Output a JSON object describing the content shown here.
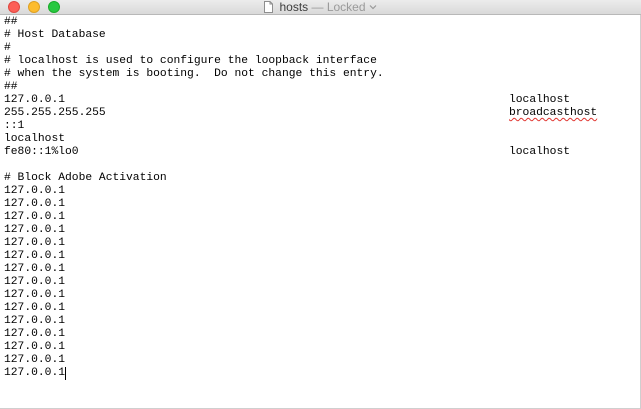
{
  "window": {
    "title": "hosts",
    "separator": " — ",
    "state": "Locked"
  },
  "editor": {
    "lines": [
      {
        "text": "##",
        "host": ""
      },
      {
        "text": "# Host Database",
        "host": ""
      },
      {
        "text": "#",
        "host": ""
      },
      {
        "text": "# localhost is used to configure the loopback interface",
        "host": ""
      },
      {
        "text": "# when the system is booting.  Do not change this entry.",
        "host": ""
      },
      {
        "text": "##",
        "host": ""
      },
      {
        "text": "127.0.0.1",
        "host": "localhost"
      },
      {
        "text": "255.255.255.255",
        "host": "broadcasthost",
        "misspelled": true
      },
      {
        "text": "::1",
        "host": ""
      },
      {
        "text": "localhost",
        "host": ""
      },
      {
        "text": "fe80::1%lo0",
        "host": "localhost"
      },
      {
        "text": "",
        "host": ""
      },
      {
        "text": "# Block Adobe Activation",
        "host": ""
      },
      {
        "text": "127.0.0.1",
        "host": ""
      },
      {
        "text": "127.0.0.1",
        "host": ""
      },
      {
        "text": "127.0.0.1",
        "host": ""
      },
      {
        "text": "127.0.0.1",
        "host": ""
      },
      {
        "text": "127.0.0.1",
        "host": ""
      },
      {
        "text": "127.0.0.1",
        "host": ""
      },
      {
        "text": "127.0.0.1",
        "host": ""
      },
      {
        "text": "127.0.0.1",
        "host": ""
      },
      {
        "text": "127.0.0.1",
        "host": ""
      },
      {
        "text": "127.0.0.1",
        "host": ""
      },
      {
        "text": "127.0.0.1",
        "host": ""
      },
      {
        "text": "127.0.0.1",
        "host": ""
      },
      {
        "text": "127.0.0.1",
        "host": ""
      },
      {
        "text": "127.0.0.1",
        "host": ""
      },
      {
        "text": "127.0.0.1",
        "host": "",
        "caret": true
      }
    ]
  },
  "icons": {
    "close": "close-button-icon",
    "minimize": "minimize-button-icon",
    "zoom": "zoom-button-icon",
    "document": "document-icon",
    "chevron": "chevron-down-icon"
  },
  "colors": {
    "close": "#fc5f57",
    "minimize": "#fdbc2e",
    "zoom": "#28c840",
    "spell_underline": "#e0342f"
  }
}
